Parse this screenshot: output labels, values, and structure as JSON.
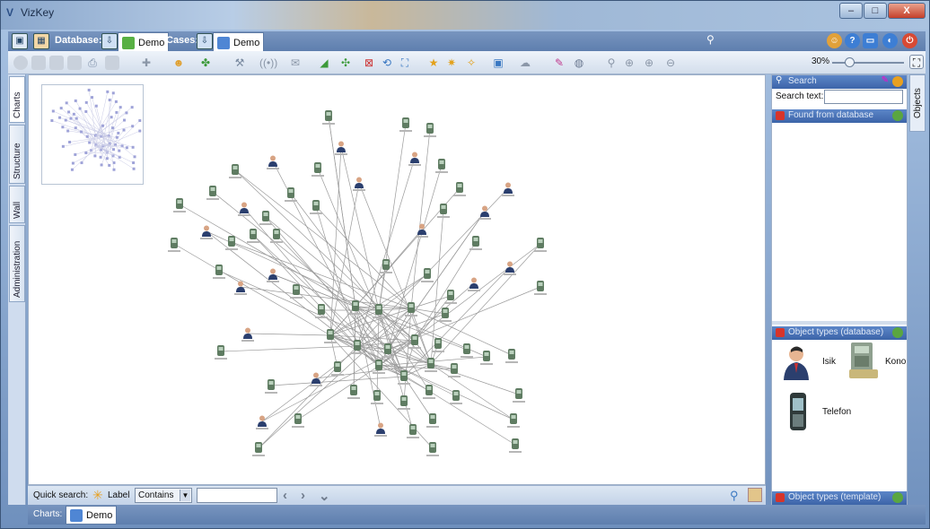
{
  "window": {
    "app_name": "VizKey"
  },
  "header": {
    "database_label": "Database:",
    "database_tab": "Demo",
    "cases_label": "Cases:",
    "cases_tab": "Demo"
  },
  "toolbar": {
    "zoom_value": "30%"
  },
  "left_tabs": [
    "Charts",
    "Structure",
    "Wall",
    "Administration"
  ],
  "quick_search": {
    "label": "Quick search:",
    "field_label": "Label",
    "match_mode": "Contains",
    "value": ""
  },
  "charts_bar": {
    "label": "Charts:",
    "tab": "Demo"
  },
  "right_panel": {
    "vertical_tab": "Objects",
    "search_title": "Search",
    "search_text_label": "Search text:",
    "search_value": "",
    "found_title": "Found from database",
    "object_types_db_title": "Object types (database)",
    "object_types_tpl_title": "Object types (template)",
    "object_types": [
      "Isik",
      "Kono",
      "Telefon"
    ]
  },
  "colors": {
    "accent": "#3c64a8",
    "person_icon": "#2b3f6e",
    "phone_icon": "#6f8a6a",
    "edge": "#8c8c8c"
  }
}
